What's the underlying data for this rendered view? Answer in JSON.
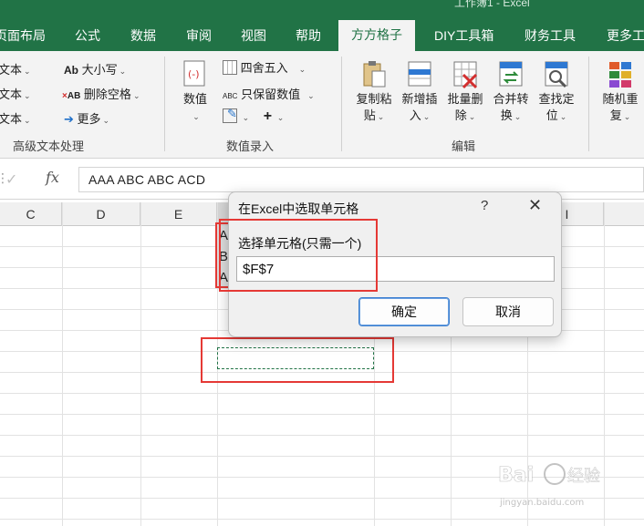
{
  "window": {
    "title": "工作簿1 - Excel"
  },
  "tabs": [
    {
      "label": "页面布局"
    },
    {
      "label": "公式"
    },
    {
      "label": "数据"
    },
    {
      "label": "审阅"
    },
    {
      "label": "视图"
    },
    {
      "label": "帮助"
    },
    {
      "label": "方方格子",
      "active": true
    },
    {
      "label": "DIY工具箱"
    },
    {
      "label": "财务工具"
    },
    {
      "label": "更多工"
    }
  ],
  "ribbon": {
    "text_group": {
      "items": [
        "文本",
        "文本",
        "文本"
      ],
      "size_label": "大小写",
      "remove_space_label": "删除空格",
      "more_label": "更多",
      "group_label": "高级文本处理"
    },
    "number_group": {
      "value_label": "数值",
      "round_label": "四舍五入",
      "keep_number_label": "只保留数值",
      "group_label": "数值录入"
    },
    "edit_group": {
      "copy_paste": [
        "复制粘",
        "贴"
      ],
      "add_insert": [
        "新增插",
        "入"
      ],
      "batch_delete": [
        "批量删",
        "除"
      ],
      "merge_convert": [
        "合并转",
        "换"
      ],
      "find_locate": [
        "查找定",
        "位"
      ],
      "group_label": "编辑"
    },
    "random_group": {
      "label": [
        "随机重",
        "复"
      ]
    }
  },
  "formula_bar": {
    "content": "AAA  ABC  ABC  ACD"
  },
  "columns": [
    "C",
    "D",
    "E",
    "I"
  ],
  "cells": {
    "f_column_partial": [
      "A",
      "B",
      "A"
    ]
  },
  "dialog": {
    "title": "在Excel中选取单元格",
    "help": "?",
    "close": "✕",
    "prompt": "选择单元格(只需一个)",
    "input_value": "$F$7",
    "ok_label": "确定",
    "cancel_label": "取消"
  },
  "colors": {
    "excel_green": "#217346",
    "highlight_red": "#e53935"
  }
}
